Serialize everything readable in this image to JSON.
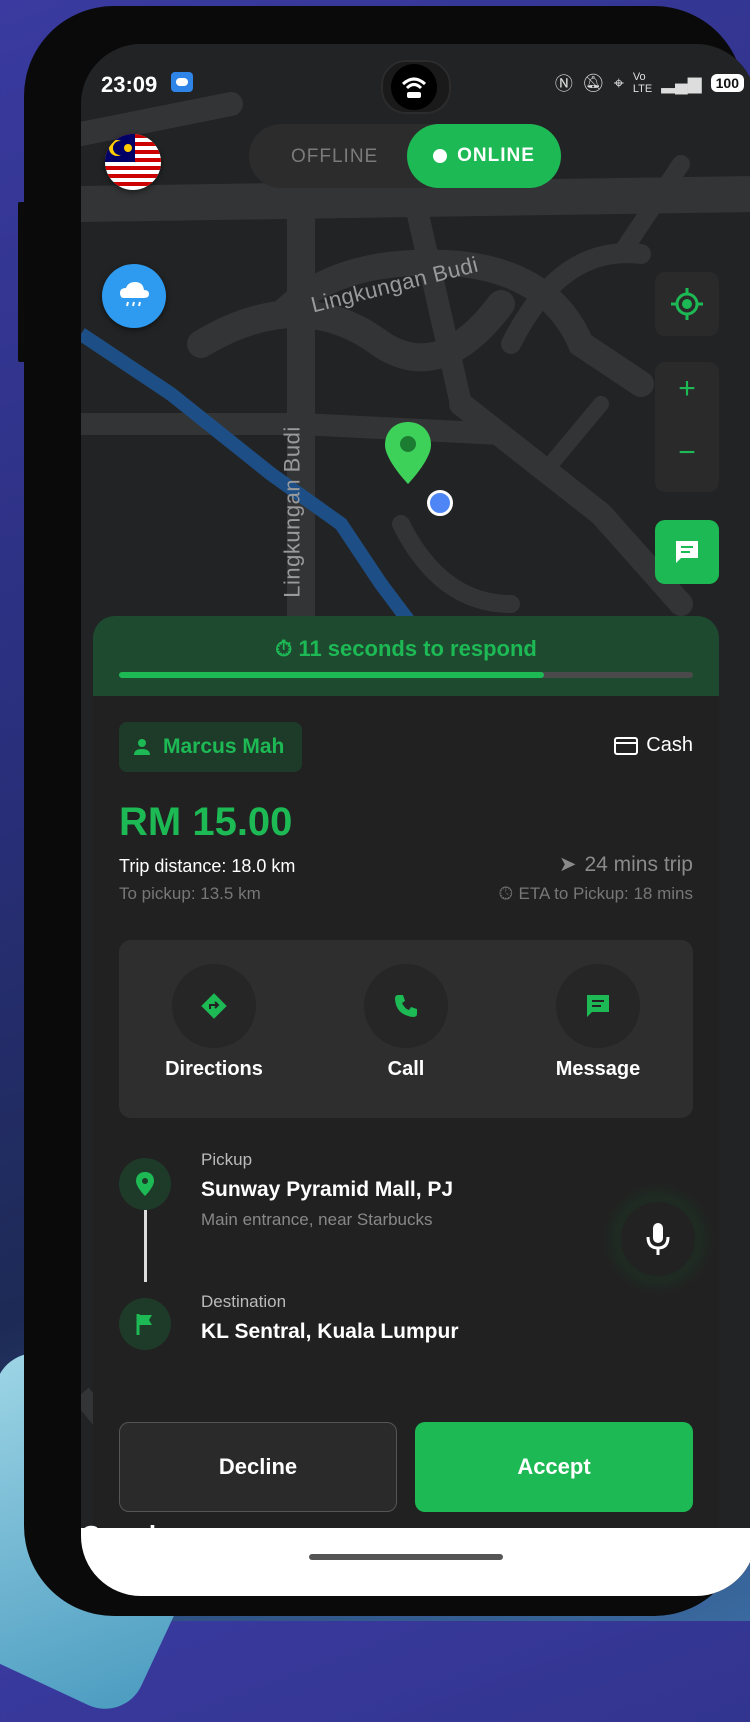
{
  "status_bar": {
    "time": "23:09",
    "icons": [
      "nfc-icon",
      "mute-icon",
      "location-icon",
      "volte-icon",
      "5g-signal-icon"
    ],
    "battery": "100"
  },
  "header": {
    "offline_label": "OFFLINE",
    "online_label": "ONLINE",
    "selected": "ONLINE"
  },
  "map": {
    "street_labels": [
      "Lingkungan Budi",
      "Lingkungan Budi"
    ],
    "zoom_in": "+",
    "zoom_out": "−",
    "attribution": "Google"
  },
  "request": {
    "countdown": "11 seconds to respond",
    "countdown_progress_percent": 74,
    "rider_name": "Marcus Mah",
    "payment_method": "Cash",
    "fare": "RM 15.00",
    "trip_distance": "Trip distance: 18.0 km",
    "to_pickup": "To pickup: 13.5 km",
    "trip_duration": "24 mins trip",
    "eta_pickup": "ETA to Pickup: 18 mins"
  },
  "actions": [
    {
      "label": "Directions",
      "icon": "directions-icon"
    },
    {
      "label": "Call",
      "icon": "phone-icon"
    },
    {
      "label": "Message",
      "icon": "message-icon"
    }
  ],
  "route": {
    "pickup_caption": "Pickup",
    "pickup_name": "Sunway Pyramid Mall, PJ",
    "pickup_note": "Main entrance, near Starbucks",
    "destination_caption": "Destination",
    "destination_name": "KL Sentral, Kuala Lumpur"
  },
  "buttons": {
    "decline": "Decline",
    "accept": "Accept"
  },
  "colors": {
    "accent": "#1db954",
    "panel": "#212121",
    "timer_bg": "#1e4a30"
  }
}
